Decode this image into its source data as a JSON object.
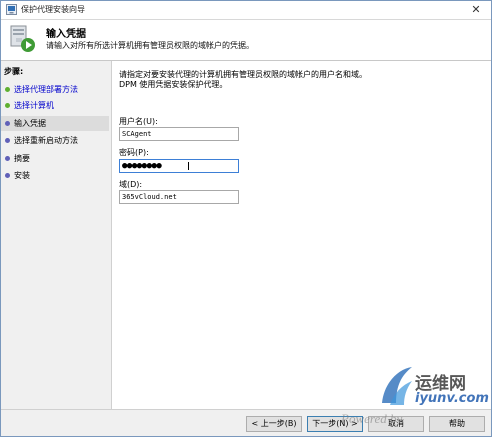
{
  "window": {
    "title": "保护代理安装向导",
    "close_glyph": "✕"
  },
  "header": {
    "title": "输入凭据",
    "subtitle": "请输入对所有所选计算机拥有管理员权限的域帐户的凭据。"
  },
  "sidebar": {
    "heading": "步骤:",
    "steps": [
      {
        "label": "选择代理部署方法",
        "state": "done"
      },
      {
        "label": "选择计算机",
        "state": "done"
      },
      {
        "label": "输入凭据",
        "state": "current"
      },
      {
        "label": "选择重新启动方法",
        "state": "pending"
      },
      {
        "label": "摘要",
        "state": "pending"
      },
      {
        "label": "安装",
        "state": "pending"
      }
    ]
  },
  "main": {
    "intro_line1": "请指定对要安装代理的计算机拥有管理员权限的域帐户的用户名和域。",
    "intro_line2": "DPM 使用凭据安装保护代理。",
    "username": {
      "label": "用户名(U):",
      "value": "SCAgent"
    },
    "password": {
      "label": "密码(P):",
      "mask": "●●●●●●●●"
    },
    "domain": {
      "label": "域(D):",
      "value": "365vCloud.net"
    }
  },
  "footer": {
    "back_label": "< 上一步(B)",
    "next_label": "下一步(N) >",
    "cancel_label": "取消",
    "help_label": "帮助"
  },
  "watermark": {
    "text": "Powered by",
    "brand_cn": "运维网",
    "brand_url": "iyunv.com"
  },
  "colors": {
    "done_dot": "#5fb030",
    "pending_dot": "#6060b8",
    "link": "#0000cc",
    "current_bg": "#dcdcdc"
  }
}
